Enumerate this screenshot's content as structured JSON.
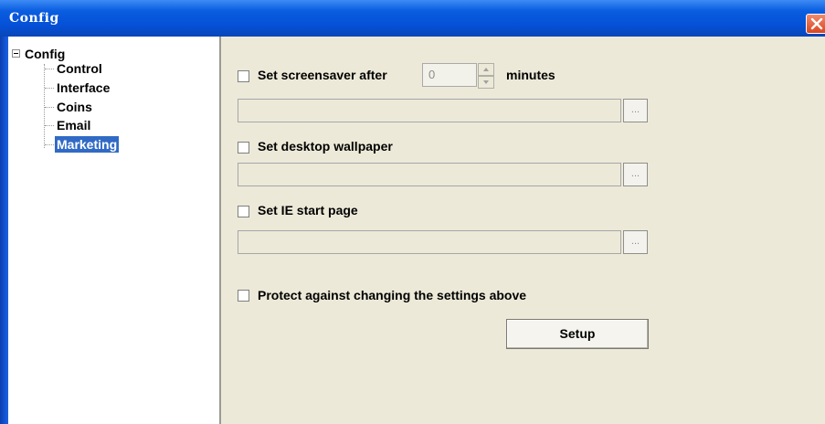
{
  "window": {
    "title": "Config"
  },
  "tree": {
    "root": {
      "label": "Config",
      "expanded": true
    },
    "items": [
      {
        "label": "Control",
        "selected": false
      },
      {
        "label": "Interface",
        "selected": false
      },
      {
        "label": "Coins",
        "selected": false
      },
      {
        "label": "Email",
        "selected": false
      },
      {
        "label": "Marketing",
        "selected": true
      }
    ]
  },
  "marketing": {
    "screensaver": {
      "checkbox_label": "Set screensaver after",
      "checked": false,
      "minutes_value": "0",
      "unit_label": "minutes",
      "path_value": "",
      "browse_label": "..."
    },
    "wallpaper": {
      "checkbox_label": "Set desktop wallpaper",
      "checked": false,
      "path_value": "",
      "browse_label": "..."
    },
    "ie_start_page": {
      "checkbox_label": "Set IE start page",
      "checked": false,
      "path_value": "",
      "browse_label": "..."
    },
    "protect": {
      "checkbox_label": "Protect against changing the settings above",
      "checked": false
    },
    "setup_label": "Setup"
  },
  "colors": {
    "titlebar": "#0550d6",
    "selection": "#316ac5",
    "panel": "#ece9d8",
    "close_button": "#d9461f"
  },
  "icons": {
    "close": "close-icon",
    "tree_expander": "minus-box-icon",
    "spin_up": "arrow-up-icon",
    "spin_down": "arrow-down-icon"
  }
}
